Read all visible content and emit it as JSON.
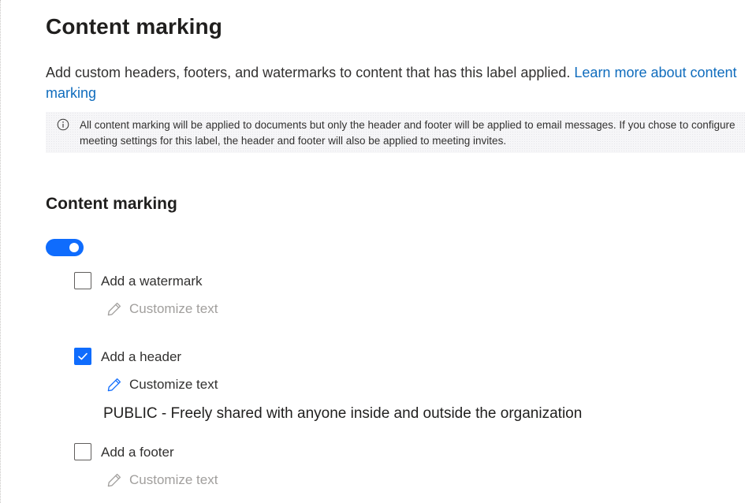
{
  "page": {
    "title": "Content marking",
    "description": "Add custom headers, footers, and watermarks to content that has this label applied.",
    "learn_more_link": "Learn more about content marking",
    "info_message": "All content marking will be applied to documents but only the header and footer will be applied to email messages. If you chose to configure meeting settings for this label, the header and footer will also be applied to meeting invites."
  },
  "section": {
    "title": "Content marking",
    "toggle_on": true
  },
  "options": {
    "watermark": {
      "label": "Add a watermark",
      "checked": false,
      "customize_label": "Customize text"
    },
    "header": {
      "label": "Add a header",
      "checked": true,
      "customize_label": "Customize text",
      "text": "PUBLIC - Freely shared with anyone inside and outside the organization"
    },
    "footer": {
      "label": "Add a footer",
      "checked": false,
      "customize_label": "Customize text"
    }
  },
  "colors": {
    "accent": "#0f6cfd",
    "link": "#0f6cbd",
    "disabled_text": "#a19f9d"
  }
}
